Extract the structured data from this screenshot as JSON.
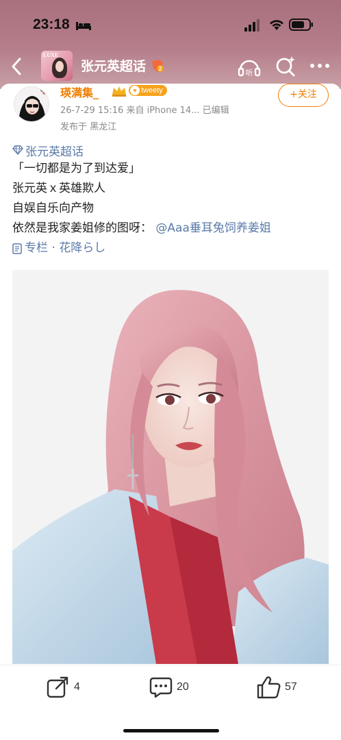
{
  "status_bar": {
    "time": "23:18",
    "icons": [
      "bed-icon",
      "signal-icon",
      "wifi-icon",
      "battery-icon"
    ]
  },
  "nav": {
    "title": "张元英超话",
    "thumb_text": "LUXE",
    "icons": [
      "back-icon",
      "listen-icon",
      "search-icon",
      "more-icon"
    ],
    "title_color": "#ffffff",
    "header_bg": "#b07885"
  },
  "post": {
    "author": {
      "name": "瑛满集_",
      "badge_text": "tweety",
      "name_color": "#f07e00"
    },
    "meta": "26-7-29 15:16  来自 iPhone 14...  已编辑",
    "location": "发布于 黑龙江",
    "follow_label": "+关注",
    "topic": "张元英超话",
    "lines": [
      "「一切都是为了到达爱」",
      "张元英ｘ英雄欺人",
      "自娱自乐向产物"
    ],
    "credit_prefix": "依然是我家姜姐修的图呀：",
    "mention": "@Aaa垂耳兔饲养姜姐",
    "special_column": "专栏 · 花降らし",
    "link_color": "#5a79a8"
  },
  "actions": {
    "repost_count": "4",
    "comment_count": "20",
    "like_count": "57"
  }
}
